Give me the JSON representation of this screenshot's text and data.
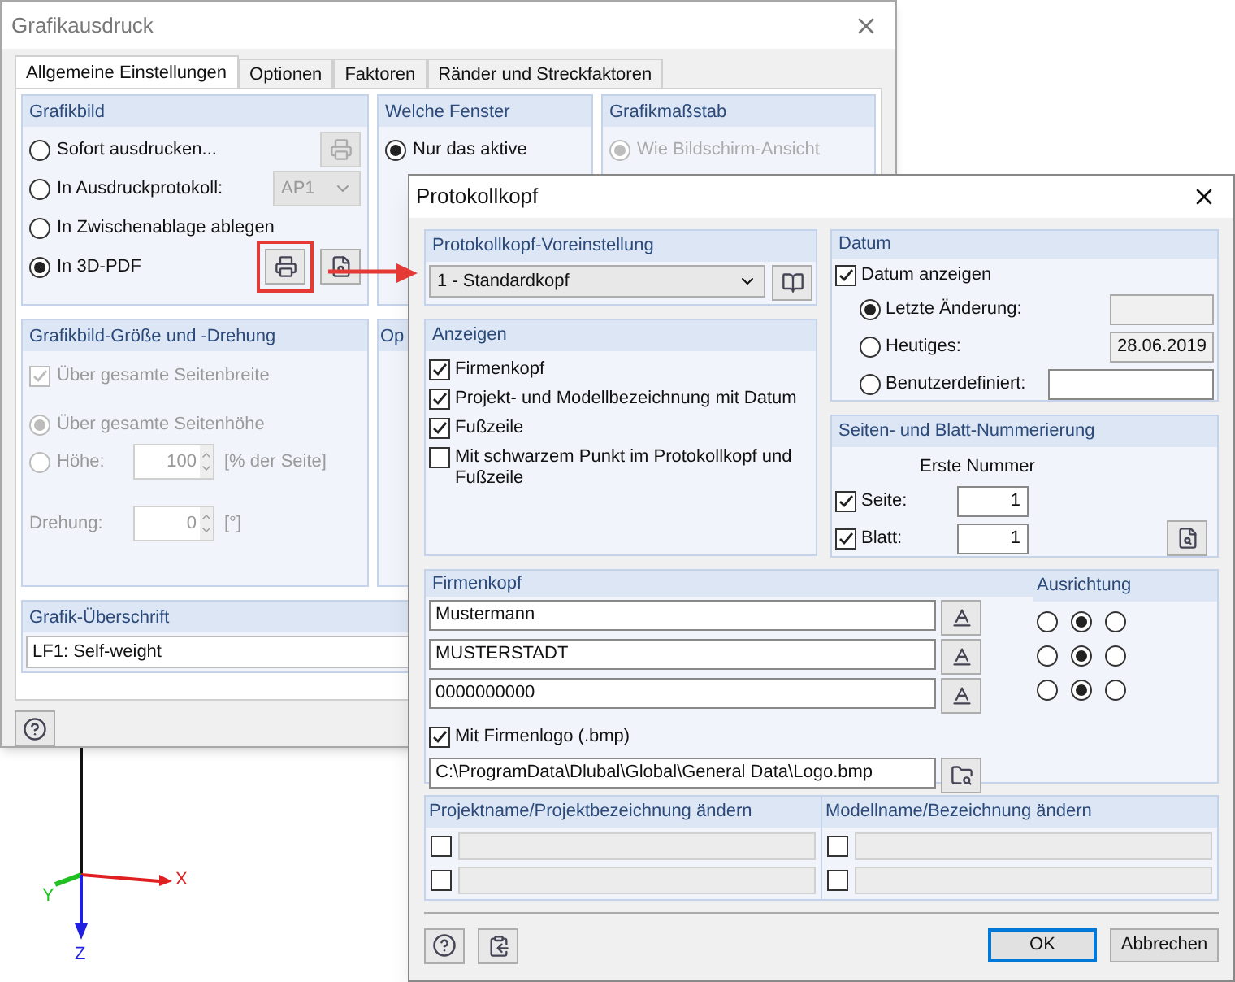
{
  "axes": {
    "labels": [
      "X",
      "Y",
      "Z"
    ]
  },
  "main_dialog": {
    "title": "Grafikausdruck",
    "tabs": [
      {
        "label": "Allgemeine Einstellungen",
        "selected": true
      },
      {
        "label": "Optionen",
        "selected": false
      },
      {
        "label": "Faktoren",
        "selected": false
      },
      {
        "label": "Ränder und Streckfaktoren",
        "selected": false
      }
    ],
    "grafikbild": {
      "title": "Grafikbild",
      "options": [
        {
          "kind": "button",
          "label": "Sofort ausdrucken...",
          "selected": false
        },
        {
          "kind": "dropdown",
          "label": "In Ausdruckprotokoll:",
          "selected": false,
          "value": "AP1"
        },
        {
          "kind": "plain",
          "label": "In Zwischenablage ablegen",
          "selected": false
        },
        {
          "kind": "buttons",
          "label": "In 3D-PDF",
          "selected": true,
          "highlighted": true
        }
      ]
    },
    "welche_fenster": {
      "title": "Welche Fenster",
      "options": [
        {
          "label": "Nur das aktive",
          "selected": true,
          "disabled": false
        }
      ]
    },
    "grafikmassstab": {
      "title": "Grafikmaßstab",
      "options": [
        {
          "label": "Wie Bildschirm-Ansicht",
          "selected": true,
          "disabled": true
        }
      ]
    },
    "groesse": {
      "title": "Grafikbild-Größe und -Drehung",
      "disabled": true,
      "rows": [
        {
          "kind": "checkbox",
          "label": "Über gesamte Seitenbreite",
          "checked": true
        },
        {
          "kind": "radio",
          "label": "Über gesamte Seitenhöhe",
          "selected": true
        },
        {
          "kind": "radio_spin",
          "label": "Höhe:",
          "selected": false,
          "value": "100",
          "unit": "[% der Seite]"
        },
        {
          "kind": "spin",
          "label": "Drehung:",
          "value": "0",
          "unit": "[°]"
        }
      ]
    },
    "optionen_group": {
      "title": "Op"
    },
    "ueberschrift": {
      "title": "Grafik-Überschrift",
      "value": "LF1: Self-weight"
    }
  },
  "header_dialog": {
    "title": "Protokollkopf",
    "preset": {
      "title": "Protokollkopf-Voreinstellung",
      "value": "1 - Standardkopf"
    },
    "anzeigen": {
      "title": "Anzeigen",
      "items": [
        {
          "label": "Firmenkopf",
          "checked": true
        },
        {
          "label": "Projekt- und Modellbezeichnung mit Datum",
          "checked": true
        },
        {
          "label": "Fußzeile",
          "checked": true
        },
        {
          "label": "Mit schwarzem Punkt im Protokollkopf und Fußzeile",
          "checked": false
        }
      ]
    },
    "datum": {
      "title": "Datum",
      "show": {
        "label": "Datum anzeigen",
        "checked": true
      },
      "options": [
        {
          "label": "Letzte Änderung:",
          "selected": true,
          "readonly": true
        },
        {
          "label": "Heutiges:",
          "selected": false,
          "readonly": true,
          "value": "28.06.2019"
        },
        {
          "label": "Benutzerdefiniert:",
          "selected": false,
          "readonly": false
        }
      ]
    },
    "nummerierung": {
      "title": "Seiten- und Blatt-Nummerierung",
      "column_label": "Erste Nummer",
      "rows": [
        {
          "label": "Seite:",
          "checked": true,
          "value": "1"
        },
        {
          "label": "Blatt:",
          "checked": true,
          "value": "1"
        }
      ]
    },
    "firmenkopf": {
      "title": "Firmenkopf",
      "alignment_title": "Ausrichtung",
      "lines": [
        {
          "value": "Mustermann",
          "alignment": [
            {
              "selected": false
            },
            {
              "selected": true
            },
            {
              "selected": false
            }
          ]
        },
        {
          "value": "MUSTERSTADT",
          "alignment": [
            {
              "selected": false
            },
            {
              "selected": true
            },
            {
              "selected": false
            }
          ]
        },
        {
          "value": "0000000000",
          "alignment": [
            {
              "selected": false
            },
            {
              "selected": true
            },
            {
              "selected": false
            }
          ]
        }
      ],
      "logo": {
        "label": "Mit Firmenlogo (.bmp)",
        "checked": true,
        "path": "C:\\ProgramData\\Dlubal\\Global\\General Data\\Logo.bmp"
      }
    },
    "projekt": {
      "title": "Projektname/Projektbezeichnung ändern",
      "rows": [
        {
          "checked": false
        },
        {
          "checked": false
        }
      ]
    },
    "modell": {
      "title": "Modellname/Bezeichnung ändern",
      "rows": [
        {
          "checked": false
        },
        {
          "checked": false
        }
      ]
    },
    "buttons": [
      {
        "label": "OK",
        "default": true
      },
      {
        "label": "Abbrechen",
        "default": false
      }
    ]
  }
}
